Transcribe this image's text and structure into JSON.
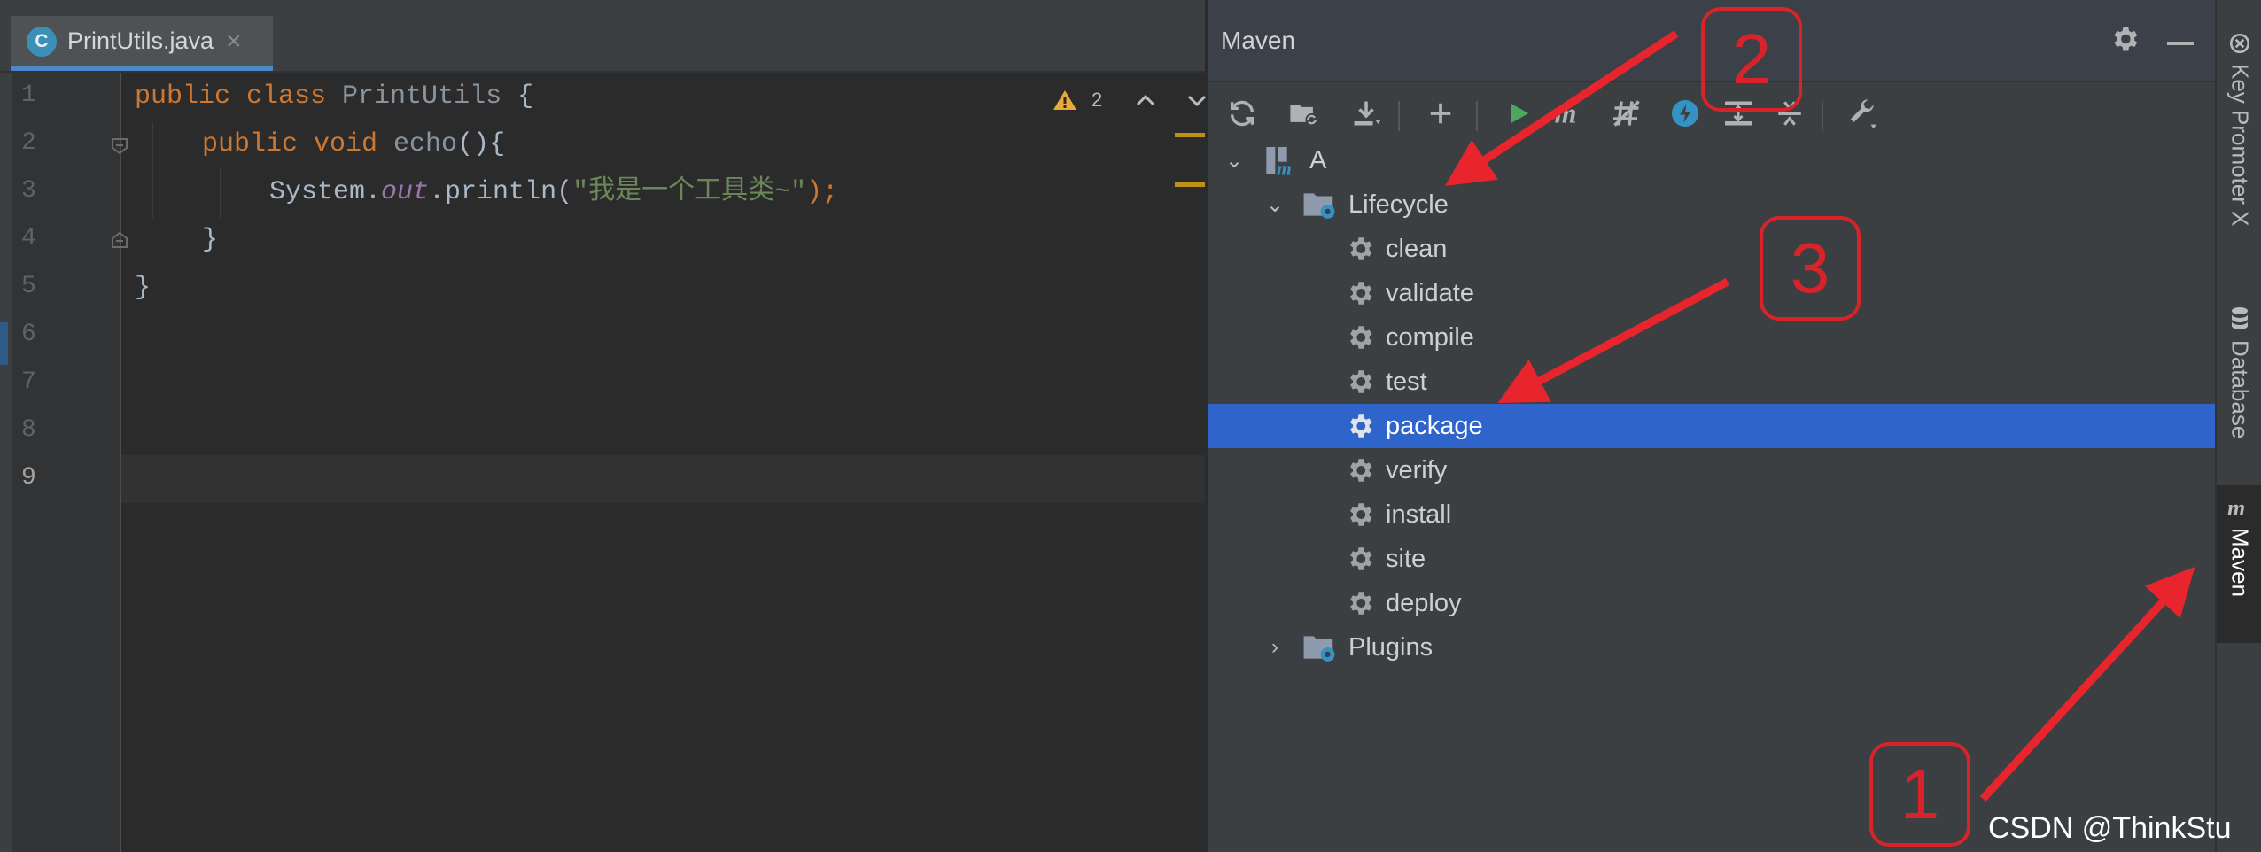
{
  "editor": {
    "tab": {
      "icon": "C",
      "title": "PrintUtils.java",
      "close": "×"
    },
    "line_numbers": [
      "1",
      "2",
      "3",
      "4",
      "5",
      "6",
      "7",
      "8",
      "9"
    ],
    "code": {
      "l1": {
        "kw": "public class ",
        "cls": "PrintUtils",
        "rest": " {"
      },
      "l2": {
        "kw": "public void ",
        "cls": "echo",
        "rest": "(){"
      },
      "l3": {
        "pre": "System.",
        "fld": "out",
        "mid": ".println(",
        "str": "\"我是一个工具类~\"",
        "kw": ");"
      },
      "l4": {
        "rest": "}"
      },
      "l5": {
        "rest": "}"
      }
    },
    "inspections": {
      "warning_count": "2",
      "icon": "warning-icon"
    }
  },
  "maven": {
    "title": "Maven",
    "toolbar": [
      "reload-icon",
      "folder-sync-icon",
      "download-icon",
      "add-icon",
      "run-icon",
      "maven-goal-icon",
      "skip-tests-icon",
      "offline-icon",
      "show-deps-icon",
      "collapse-icon",
      "settings-wrench-icon"
    ],
    "tree": {
      "root": "A",
      "lifecycle": "Lifecycle",
      "goals": [
        "clean",
        "validate",
        "compile",
        "test",
        "package",
        "verify",
        "install",
        "site",
        "deploy"
      ],
      "selected": "package",
      "plugins": "Plugins"
    }
  },
  "right_strip": {
    "key_promoter": "Key Promoter X",
    "database": "Database",
    "maven": "Maven"
  },
  "annotations": {
    "callout_1": "1",
    "callout_2": "2",
    "callout_3": "3",
    "color": "#d8232a"
  },
  "watermark": "CSDN @ThinkStu"
}
